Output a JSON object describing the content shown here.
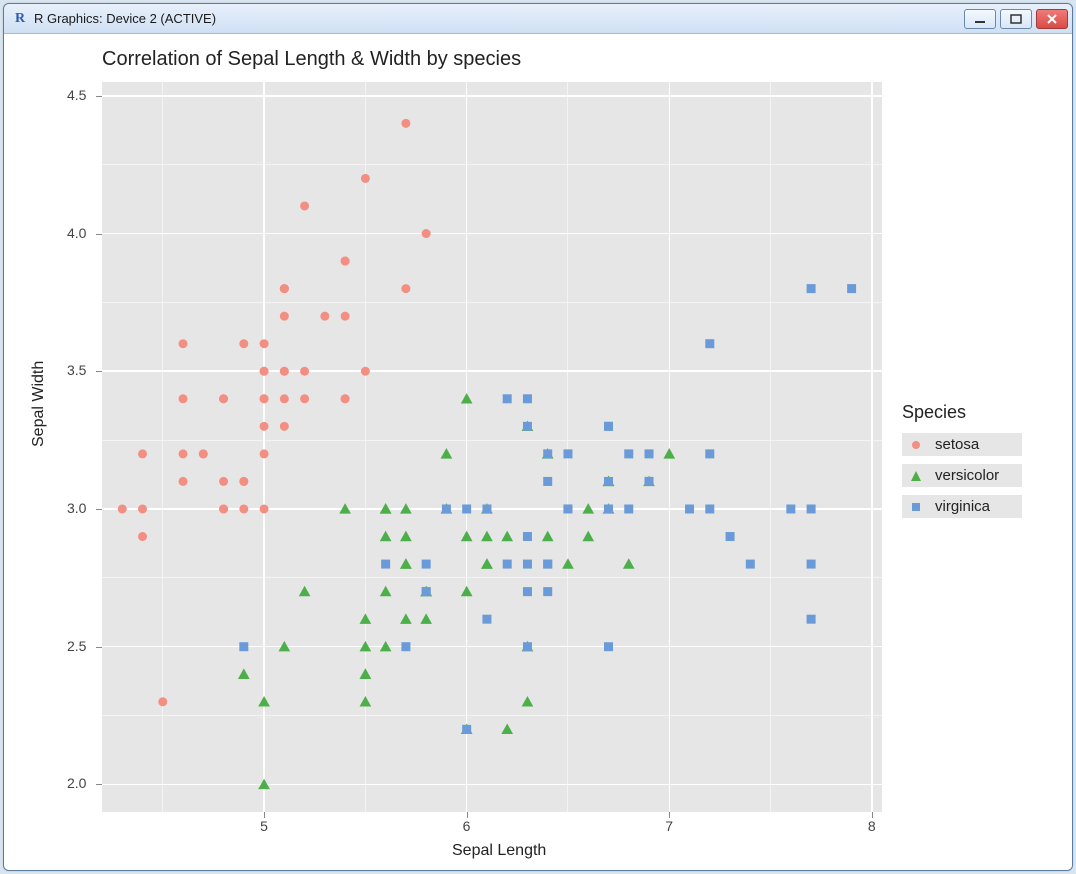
{
  "window": {
    "title": "R Graphics: Device 2 (ACTIVE)",
    "app_icon_letter": "R"
  },
  "chart_data": {
    "type": "scatter",
    "title": "Correlation of Sepal Length & Width by species",
    "xlabel": "Sepal Length",
    "ylabel": "Sepal Width",
    "xlim": [
      4.2,
      8.05
    ],
    "ylim": [
      1.9,
      4.55
    ],
    "x_ticks": [
      5,
      6,
      7,
      8
    ],
    "y_ticks": [
      2.0,
      2.5,
      3.0,
      3.5,
      4.0,
      4.5
    ],
    "x_minor": [
      4.5,
      5.5,
      6.5,
      7.5
    ],
    "y_minor": [
      2.25,
      2.75,
      3.25,
      3.75,
      4.25
    ],
    "legend_title": "Species",
    "series": [
      {
        "name": "setosa",
        "color": "#f28e82",
        "marker": "circle",
        "data": [
          [
            5.1,
            3.5
          ],
          [
            4.9,
            3.0
          ],
          [
            4.7,
            3.2
          ],
          [
            4.6,
            3.1
          ],
          [
            5.0,
            3.6
          ],
          [
            5.4,
            3.9
          ],
          [
            4.6,
            3.4
          ],
          [
            5.0,
            3.4
          ],
          [
            4.4,
            2.9
          ],
          [
            4.9,
            3.1
          ],
          [
            5.4,
            3.7
          ],
          [
            4.8,
            3.4
          ],
          [
            4.8,
            3.0
          ],
          [
            4.3,
            3.0
          ],
          [
            5.8,
            4.0
          ],
          [
            5.7,
            4.4
          ],
          [
            5.4,
            3.9
          ],
          [
            5.1,
            3.5
          ],
          [
            5.7,
            3.8
          ],
          [
            5.1,
            3.8
          ],
          [
            5.4,
            3.4
          ],
          [
            5.1,
            3.7
          ],
          [
            4.6,
            3.6
          ],
          [
            5.1,
            3.3
          ],
          [
            4.8,
            3.4
          ],
          [
            5.0,
            3.0
          ],
          [
            5.0,
            3.4
          ],
          [
            5.2,
            3.5
          ],
          [
            5.2,
            3.4
          ],
          [
            4.7,
            3.2
          ],
          [
            4.8,
            3.1
          ],
          [
            5.4,
            3.4
          ],
          [
            5.2,
            4.1
          ],
          [
            5.5,
            4.2
          ],
          [
            4.9,
            3.1
          ],
          [
            5.0,
            3.2
          ],
          [
            5.5,
            3.5
          ],
          [
            4.9,
            3.6
          ],
          [
            4.4,
            3.0
          ],
          [
            5.1,
            3.4
          ],
          [
            5.0,
            3.5
          ],
          [
            4.5,
            2.3
          ],
          [
            4.4,
            3.2
          ],
          [
            5.0,
            3.5
          ],
          [
            5.1,
            3.8
          ],
          [
            4.8,
            3.0
          ],
          [
            5.1,
            3.8
          ],
          [
            4.6,
            3.2
          ],
          [
            5.3,
            3.7
          ],
          [
            5.0,
            3.3
          ]
        ]
      },
      {
        "name": "versicolor",
        "color": "#4daf4a",
        "marker": "triangle",
        "data": [
          [
            7.0,
            3.2
          ],
          [
            6.4,
            3.2
          ],
          [
            6.9,
            3.1
          ],
          [
            5.5,
            2.3
          ],
          [
            6.5,
            2.8
          ],
          [
            5.7,
            2.8
          ],
          [
            6.3,
            3.3
          ],
          [
            4.9,
            2.4
          ],
          [
            6.6,
            2.9
          ],
          [
            5.2,
            2.7
          ],
          [
            5.0,
            2.0
          ],
          [
            5.9,
            3.0
          ],
          [
            6.0,
            2.2
          ],
          [
            6.1,
            2.9
          ],
          [
            5.6,
            2.9
          ],
          [
            6.7,
            3.1
          ],
          [
            5.6,
            3.0
          ],
          [
            5.8,
            2.7
          ],
          [
            6.2,
            2.2
          ],
          [
            5.6,
            2.5
          ],
          [
            5.9,
            3.2
          ],
          [
            6.1,
            2.8
          ],
          [
            6.3,
            2.5
          ],
          [
            6.1,
            2.8
          ],
          [
            6.4,
            2.9
          ],
          [
            6.6,
            3.0
          ],
          [
            6.8,
            2.8
          ],
          [
            6.7,
            3.0
          ],
          [
            6.0,
            2.9
          ],
          [
            5.7,
            2.6
          ],
          [
            5.5,
            2.4
          ],
          [
            5.5,
            2.4
          ],
          [
            5.8,
            2.7
          ],
          [
            6.0,
            2.7
          ],
          [
            5.4,
            3.0
          ],
          [
            6.0,
            3.4
          ],
          [
            6.7,
            3.1
          ],
          [
            6.3,
            2.3
          ],
          [
            5.6,
            3.0
          ],
          [
            5.5,
            2.5
          ],
          [
            5.5,
            2.6
          ],
          [
            6.1,
            3.0
          ],
          [
            5.8,
            2.6
          ],
          [
            5.0,
            2.3
          ],
          [
            5.6,
            2.7
          ],
          [
            5.7,
            3.0
          ],
          [
            5.7,
            2.9
          ],
          [
            6.2,
            2.9
          ],
          [
            5.1,
            2.5
          ],
          [
            5.7,
            2.8
          ]
        ]
      },
      {
        "name": "virginica",
        "color": "#6a9bd8",
        "marker": "square",
        "data": [
          [
            6.3,
            3.3
          ],
          [
            5.8,
            2.7
          ],
          [
            7.1,
            3.0
          ],
          [
            6.3,
            2.9
          ],
          [
            6.5,
            3.0
          ],
          [
            7.6,
            3.0
          ],
          [
            4.9,
            2.5
          ],
          [
            7.3,
            2.9
          ],
          [
            6.7,
            2.5
          ],
          [
            7.2,
            3.6
          ],
          [
            6.5,
            3.2
          ],
          [
            6.4,
            2.7
          ],
          [
            6.8,
            3.0
          ],
          [
            5.7,
            2.5
          ],
          [
            5.8,
            2.8
          ],
          [
            6.4,
            3.2
          ],
          [
            6.5,
            3.0
          ],
          [
            7.7,
            3.8
          ],
          [
            7.7,
            2.6
          ],
          [
            6.0,
            2.2
          ],
          [
            6.9,
            3.2
          ],
          [
            5.6,
            2.8
          ],
          [
            7.7,
            2.8
          ],
          [
            6.3,
            2.7
          ],
          [
            6.7,
            3.3
          ],
          [
            7.2,
            3.2
          ],
          [
            6.2,
            2.8
          ],
          [
            6.1,
            3.0
          ],
          [
            6.4,
            2.8
          ],
          [
            7.2,
            3.0
          ],
          [
            7.4,
            2.8
          ],
          [
            7.9,
            3.8
          ],
          [
            6.4,
            2.8
          ],
          [
            6.3,
            2.8
          ],
          [
            6.1,
            2.6
          ],
          [
            7.7,
            3.0
          ],
          [
            6.3,
            3.4
          ],
          [
            6.4,
            3.1
          ],
          [
            6.0,
            3.0
          ],
          [
            6.9,
            3.1
          ],
          [
            6.7,
            3.1
          ],
          [
            6.9,
            3.1
          ],
          [
            5.8,
            2.7
          ],
          [
            6.8,
            3.2
          ],
          [
            6.7,
            3.3
          ],
          [
            6.7,
            3.0
          ],
          [
            6.3,
            2.5
          ],
          [
            6.5,
            3.0
          ],
          [
            6.2,
            3.4
          ],
          [
            5.9,
            3.0
          ]
        ]
      }
    ]
  }
}
